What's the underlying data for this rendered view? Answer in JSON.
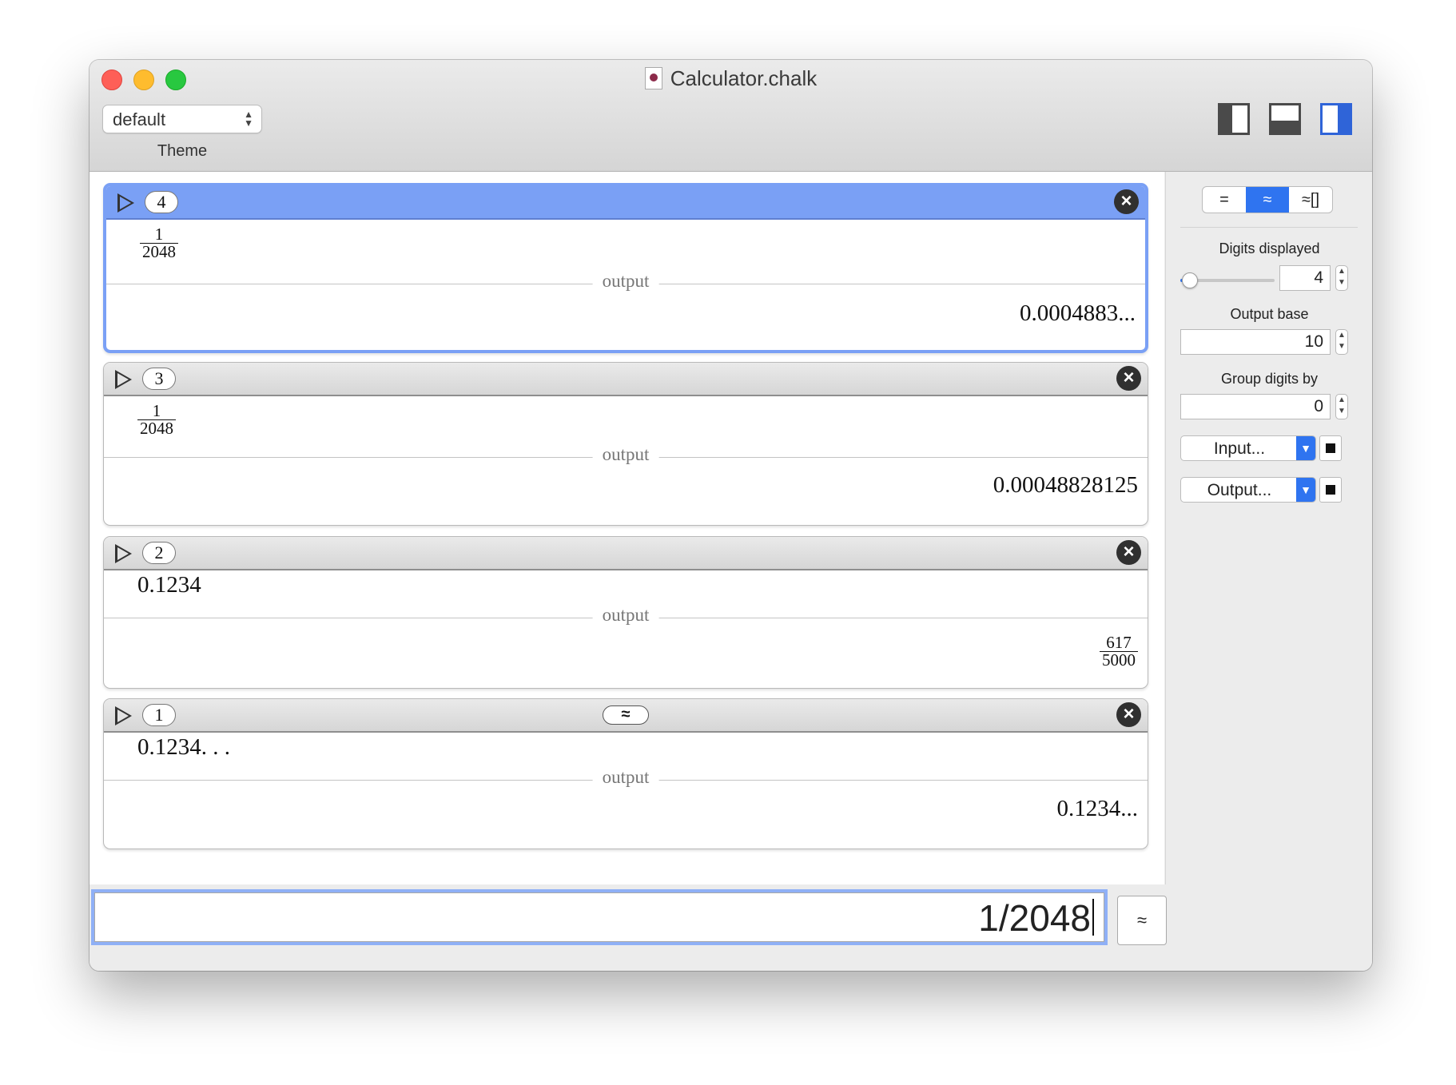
{
  "window": {
    "title": "Calculator.chalk",
    "toolbar": {
      "theme_value": "default",
      "theme_label": "Theme"
    }
  },
  "entries": [
    {
      "number": "4",
      "input_num": "1",
      "input_den": "2048",
      "divider_label": "output",
      "output": "0.0004883..."
    },
    {
      "number": "3",
      "input_num": "1",
      "input_den": "2048",
      "divider_label": "output",
      "output": "0.00048828125"
    },
    {
      "number": "2",
      "input": "0.1234",
      "divider_label": "output",
      "output_num": "617",
      "output_den": "5000"
    },
    {
      "number": "1",
      "badge": "≈",
      "input": "0.1234. . .",
      "divider_label": "output",
      "output": "0.1234..."
    }
  ],
  "input_bar": {
    "value": "1/2048",
    "approx_button": "≈"
  },
  "sidebar": {
    "modes": [
      "=",
      "≈",
      "≈[]"
    ],
    "active_mode": "≈",
    "digits_label": "Digits displayed",
    "digits_value": "4",
    "digits_slider_fraction": 0.15,
    "base_label": "Output base",
    "base_value": "10",
    "group_label": "Group digits by",
    "group_value": "0",
    "input_color_label": "Input...",
    "output_color_label": "Output...",
    "accent_color": "#2f74f0"
  }
}
